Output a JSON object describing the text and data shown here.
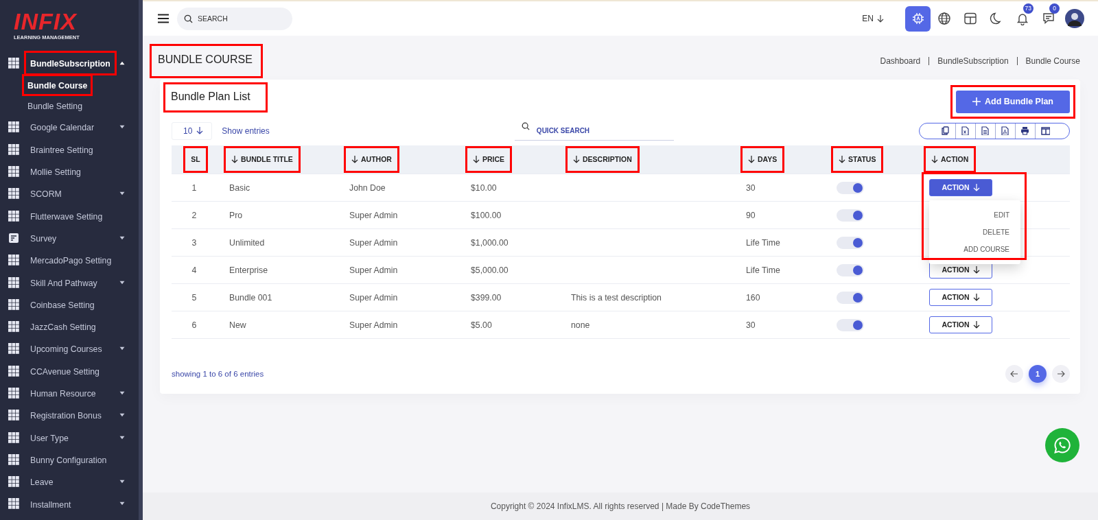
{
  "logo": {
    "wordmark": "INFIX",
    "tagline": "LEARNING MANAGEMENT"
  },
  "sidebar": {
    "items": [
      {
        "label": "BundleSubscription",
        "kind": "grid",
        "expanded": true,
        "highlighted": true,
        "children": [
          {
            "label": "Bundle Course",
            "selected": true,
            "highlighted": true
          },
          {
            "label": "Bundle Setting",
            "selected": false,
            "highlighted": false
          }
        ]
      },
      {
        "label": "Google Calendar",
        "kind": "grid",
        "expanded": false,
        "highlighted": false
      },
      {
        "label": "Braintree Setting",
        "kind": "grid",
        "highlighted": false
      },
      {
        "label": "Mollie Setting",
        "kind": "grid",
        "highlighted": false
      },
      {
        "label": "SCORM",
        "kind": "grid",
        "expanded": false,
        "highlighted": false
      },
      {
        "label": "Flutterwave Setting",
        "kind": "grid",
        "highlighted": false
      },
      {
        "label": "Survey",
        "kind": "form",
        "expanded": false,
        "highlighted": false
      },
      {
        "label": "MercadoPago Setting",
        "kind": "grid",
        "highlighted": false
      },
      {
        "label": "Skill And Pathway",
        "kind": "grid",
        "expanded": false,
        "highlighted": false
      },
      {
        "label": "Coinbase Setting",
        "kind": "grid",
        "highlighted": false
      },
      {
        "label": "JazzCash Setting",
        "kind": "grid",
        "highlighted": false
      },
      {
        "label": "Upcoming Courses",
        "kind": "grid",
        "expanded": false,
        "highlighted": false
      },
      {
        "label": "CCAvenue Setting",
        "kind": "grid",
        "highlighted": false
      },
      {
        "label": "Human Resource",
        "kind": "grid",
        "expanded": false,
        "highlighted": false
      },
      {
        "label": "Registration Bonus",
        "kind": "grid",
        "expanded": false,
        "highlighted": false
      },
      {
        "label": "User Type",
        "kind": "grid",
        "expanded": false,
        "highlighted": false
      },
      {
        "label": "Bunny Configuration",
        "kind": "grid",
        "highlighted": false
      },
      {
        "label": "Leave",
        "kind": "grid",
        "expanded": false,
        "highlighted": false
      },
      {
        "label": "Installment",
        "kind": "grid",
        "expanded": false,
        "highlighted": false
      }
    ]
  },
  "topbar": {
    "search": {
      "placeholder": "SEARCH"
    },
    "language": "EN",
    "icons": [
      {
        "kind": "chip",
        "active": true
      },
      {
        "kind": "globe",
        "active": false
      },
      {
        "kind": "layout",
        "active": false
      },
      {
        "kind": "moon",
        "active": false
      },
      {
        "kind": "bell",
        "active": false,
        "badge": "73"
      },
      {
        "kind": "chat",
        "active": false,
        "badge": "0"
      },
      {
        "kind": "avatar"
      }
    ]
  },
  "page": {
    "title": "BUNDLE COURSE",
    "title_highlighted": true,
    "breadcrumb": [
      "Dashboard",
      "BundleSubscription",
      "Bundle Course"
    ]
  },
  "card": {
    "title": "Bundle Plan List",
    "title_highlighted": true,
    "add_button": {
      "label": "Add Bundle Plan",
      "highlighted": true
    },
    "page_length": "10",
    "length_label": "Show entries",
    "quick_search": {
      "placeholder": "QUICK SEARCH"
    },
    "export_buttons": [
      {
        "kind": "copy"
      },
      {
        "kind": "excel"
      },
      {
        "kind": "csv"
      },
      {
        "kind": "pdf"
      },
      {
        "kind": "print"
      },
      {
        "kind": "columns"
      }
    ],
    "table": {
      "columns": [
        {
          "label": "SL",
          "sortable": false,
          "highlighted": true
        },
        {
          "label": "BUNDLE TITLE",
          "sortable": true,
          "highlighted": true
        },
        {
          "label": "AUTHOR",
          "sortable": true,
          "highlighted": true
        },
        {
          "label": "PRICE",
          "sortable": true,
          "highlighted": true
        },
        {
          "label": "DESCRIPTION",
          "sortable": true,
          "highlighted": true
        },
        {
          "label": "DAYS",
          "sortable": true,
          "highlighted": true
        },
        {
          "label": "STATUS",
          "sortable": true,
          "highlighted": true
        },
        {
          "label": "ACTION",
          "sortable": true,
          "highlighted": true
        }
      ],
      "rows": [
        {
          "sl": "1",
          "title": "Basic",
          "author": "John Doe",
          "price": "$10.00",
          "days": "30",
          "on": true,
          "action": {
            "label": "ACTION",
            "open": true,
            "highlighted": true,
            "menu": [
              "EDIT",
              "DELETE",
              "ADD COURSE"
            ]
          }
        },
        {
          "sl": "2",
          "title": "Pro",
          "author": "Super Admin",
          "price": "$100.00",
          "days": "90",
          "on": true
        },
        {
          "sl": "3",
          "title": "Unlimited",
          "author": "Super Admin",
          "price": "$1,000.00",
          "days": "Life Time",
          "on": true
        },
        {
          "sl": "4",
          "title": "Enterprise",
          "author": "Super Admin",
          "price": "$5,000.00",
          "days": "Life Time",
          "on": true,
          "action": {
            "label": "ACTION",
            "open": false,
            "highlighted": false
          }
        },
        {
          "sl": "5",
          "title": "Bundle 001",
          "author": "Super Admin",
          "price": "$399.00",
          "description": "This is a test description",
          "days": "160",
          "on": true,
          "action": {
            "label": "ACTION",
            "open": false,
            "highlighted": false
          }
        },
        {
          "sl": "6",
          "title": "New",
          "author": "Super Admin",
          "price": "$5.00",
          "description": "none",
          "days": "30",
          "on": true,
          "action": {
            "label": "ACTION",
            "open": false,
            "highlighted": false
          }
        }
      ]
    },
    "info": "showing 1 to 6 of 6 entries",
    "pages": [
      {
        "label": "1",
        "selected": true
      }
    ]
  },
  "footer": "Copyright © 2024 InfixLMS. All rights reserved | Made By CodeThemes"
}
